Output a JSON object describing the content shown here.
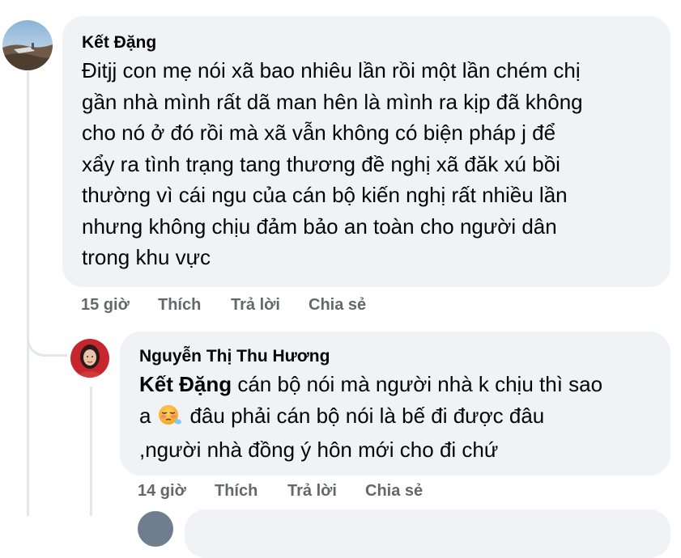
{
  "comments": [
    {
      "author": "Kết Đặng",
      "lines": [
        "Đitjj con mẹ nói xã bao nhiêu lần rồi một lần chém chị",
        "gần nhà mình rất dã man hên là mình ra kịp đã không",
        "cho nó ở đó rồi mà xã vẫn không có biện pháp j để",
        "xẩy ra tình trạng tang thương đề nghị xã đăk xú bồi",
        "thường vì cái ngu của cán bộ kiến nghị rất nhiều lần",
        "nhưng không chịu đảm bảo an toàn cho người dân",
        "trong khu vực"
      ],
      "time": "15 giờ",
      "like": "Thích",
      "reply": "Trả lời",
      "share": "Chia sẻ"
    },
    {
      "author": "Nguyễn Thị Thu Hương",
      "mention": "Kết Đặng",
      "line1_rest": " cán bộ nói mà người nhà k chịu thì sao",
      "line2_before_emoji": "a",
      "line2_after_emoji": "đâu phải cán bộ nói là bế đi được đâu",
      "line3": ",người nhà đồng ý hôn mới cho đi chứ",
      "emoji_icon": "relieved-face-emoji",
      "time": "14 giờ",
      "like": "Thích",
      "reply": "Trả lời",
      "share": "Chia sẻ"
    }
  ]
}
